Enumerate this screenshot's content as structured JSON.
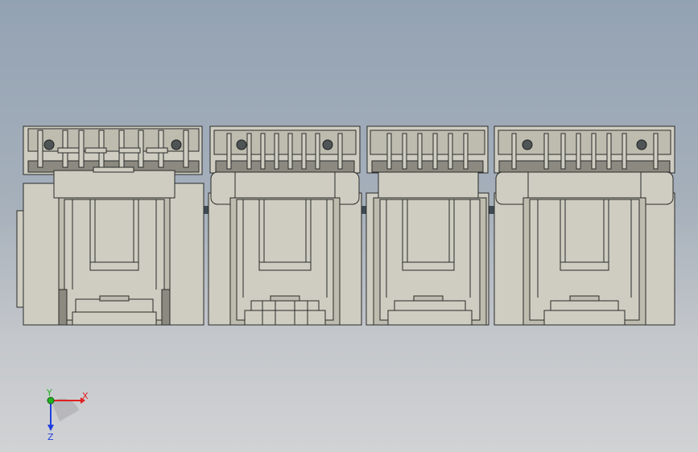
{
  "view": {
    "background_top": "#93a2b3",
    "background_bottom": "#d1d2d4",
    "part_color": "#cfcdc1",
    "edge_color": "#2a2a2a"
  },
  "triad": {
    "x_label": "X",
    "y_label": "Y",
    "z_label": "Z",
    "x_color": "#e02020",
    "y_color": "#20b020",
    "z_color": "#2040e0"
  }
}
